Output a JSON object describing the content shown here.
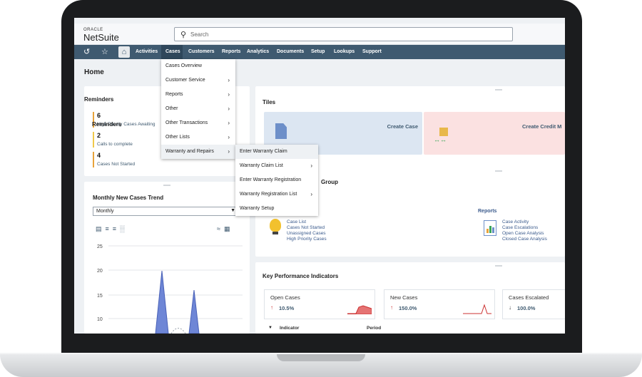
{
  "header": {
    "logo_oracle": "ORACLE",
    "logo_netsuite": "NetSuite",
    "search_placeholder": "Search"
  },
  "nav": {
    "items": [
      "Activities",
      "Cases",
      "Customers",
      "Reports",
      "Analytics",
      "Documents",
      "Setup",
      "Lookups",
      "Support"
    ],
    "active": "Cases"
  },
  "page_title": "Home",
  "reminders": {
    "title": "Reminders",
    "items": [
      {
        "count": "6",
        "label": "High Priority Cases Awaiting"
      },
      {
        "count": "2",
        "label": "Calls to complete"
      },
      {
        "count": "4",
        "label": "Cases Not Started"
      }
    ]
  },
  "trend": {
    "title": "Monthly New Cases Trend",
    "period_select": "Monthly"
  },
  "chart_data": {
    "type": "area",
    "yticks": [
      25,
      20,
      15,
      10
    ],
    "peaks": [
      20,
      16
    ]
  },
  "tiles": {
    "title": "Tiles",
    "items": [
      {
        "label": "Create Case",
        "color": "#dce6f2"
      },
      {
        "label": "Create Credit M",
        "color": "#fbe1e1"
      }
    ]
  },
  "group": {
    "title_fragment": "Group",
    "reports_heading": "Reports",
    "left_links": [
      "Case List",
      "Cases Not Started",
      "Unassigned Cases",
      "High Priority Cases"
    ],
    "report_links": [
      "Case Activity",
      "Case Escalations",
      "Open Case Analysis",
      "Closed Case Analysis"
    ]
  },
  "kpi": {
    "title": "Key Performance Indicators",
    "cards": [
      {
        "title": "Open Cases",
        "arrow": "↑",
        "value": "10.5%"
      },
      {
        "title": "New Cases",
        "arrow": "↑",
        "value": "150.0%"
      },
      {
        "title": "Cases Escalated",
        "arrow": "↓",
        "value": "100.0%"
      }
    ],
    "col_indicator": "Indicator",
    "col_period": "Period"
  },
  "cases_menu": {
    "items": [
      {
        "label": "Cases Overview",
        "has_sub": false
      },
      {
        "label": "Customer Service",
        "has_sub": true
      },
      {
        "label": "Reports",
        "has_sub": true
      },
      {
        "label": "Other",
        "has_sub": true
      },
      {
        "label": "Other Transactions",
        "has_sub": true
      },
      {
        "label": "Other Lists",
        "has_sub": true
      },
      {
        "label": "Warranty and Repairs",
        "has_sub": true
      }
    ]
  },
  "warranty_menu": {
    "items": [
      {
        "label": "Enter Warranty Claim",
        "has_sub": false
      },
      {
        "label": "Warranty Claim List",
        "has_sub": true
      },
      {
        "label": "Enter Warranty Registration",
        "has_sub": false
      },
      {
        "label": "Warranty Registration List",
        "has_sub": true
      },
      {
        "label": "Warranty Setup",
        "has_sub": false
      }
    ]
  }
}
